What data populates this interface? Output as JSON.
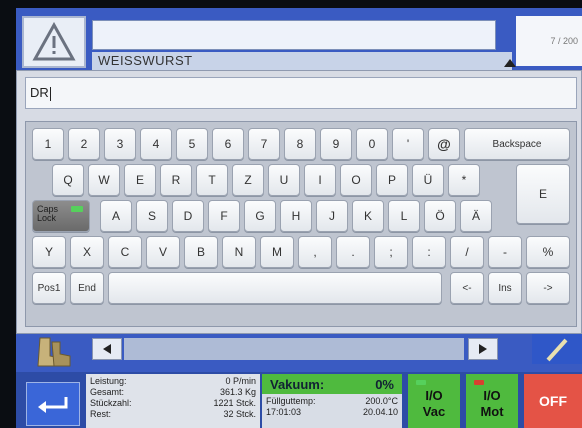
{
  "header": {
    "title_value": "",
    "product_label": "WEISSWURST",
    "counter_text": "7 / 200"
  },
  "dialog": {
    "input_value": "DR"
  },
  "keyboard": {
    "row1": [
      "1",
      "2",
      "3",
      "4",
      "5",
      "6",
      "7",
      "8",
      "9",
      "0",
      "'",
      "@",
      "Backspace"
    ],
    "row2": [
      "Q",
      "W",
      "E",
      "R",
      "T",
      "Z",
      "U",
      "I",
      "O",
      "P",
      "Ü",
      "*"
    ],
    "enter": "E",
    "caps": "Caps Lock",
    "row3": [
      "A",
      "S",
      "D",
      "F",
      "G",
      "H",
      "J",
      "K",
      "L",
      "Ö",
      "Ä"
    ],
    "row4": [
      "Y",
      "X",
      "C",
      "V",
      "B",
      "N",
      "M",
      ",",
      ".",
      ";",
      ":",
      "/",
      "-",
      "%"
    ],
    "row5": [
      "Pos1",
      "End",
      "",
      "<-",
      "Ins",
      "->"
    ]
  },
  "status": {
    "stats": [
      {
        "label": "Leistung:",
        "value": "0 P/min"
      },
      {
        "label": "Gesamt:",
        "value": "361.3 Kg"
      },
      {
        "label": "Stückzahl:",
        "value": "1221 Stck."
      },
      {
        "label": "Rest:",
        "value": "32 Stck."
      }
    ],
    "vacuum_label": "Vakuum:",
    "vacuum_value": "0%",
    "fill_temp_label": "Füllguttemp:",
    "fill_temp_value": "200.0°C",
    "time": "17:01:03",
    "date": "20.04.10",
    "io_vac_top": "I/O",
    "io_vac_bottom": "Vac",
    "io_mot_top": "I/O",
    "io_mot_bottom": "Mot",
    "off_label": "OFF"
  },
  "colors": {
    "accent_green": "#4fba3e",
    "off_red": "#e45346",
    "frame_blue": "#3a5bc2",
    "led_green": "#56d05c",
    "led_red": "#d8402f"
  },
  "icons": [
    "warning-icon",
    "up-arrow-icon",
    "left-arrow-icon",
    "right-arrow-icon",
    "boots-icon",
    "pen-icon",
    "back-arrow-icon"
  ]
}
